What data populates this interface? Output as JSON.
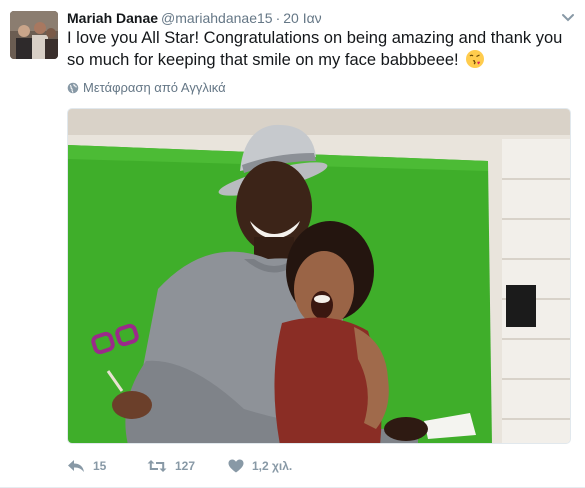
{
  "tweet": {
    "author_name": "Mariah Danae",
    "author_handle": "@mariahdanae15",
    "separator": "·",
    "timestamp": "20 Ιαν",
    "text": "I love you All Star! Congratulations on being amazing and thank you so much for keeping that smile on my face babbbeee!",
    "emoji": "face-throwing-kiss-emoji",
    "translate_label": "Μετάφραση από Αγγλικά",
    "media": {
      "description_icon": "photo",
      "colors": {
        "backdrop": "#3fae2a",
        "wall": "#e9e4dc"
      }
    },
    "actions": {
      "reply_count": "15",
      "retweet_count": "127",
      "like_count": "1,2 χιλ."
    }
  },
  "icons": {
    "reply": "reply-icon",
    "retweet": "retweet-icon",
    "like": "heart-icon",
    "caret": "chevron-down-icon",
    "translate": "globe-icon"
  },
  "colors": {
    "text": "#14171a",
    "secondary": "#657786",
    "action": "#8899a6"
  }
}
